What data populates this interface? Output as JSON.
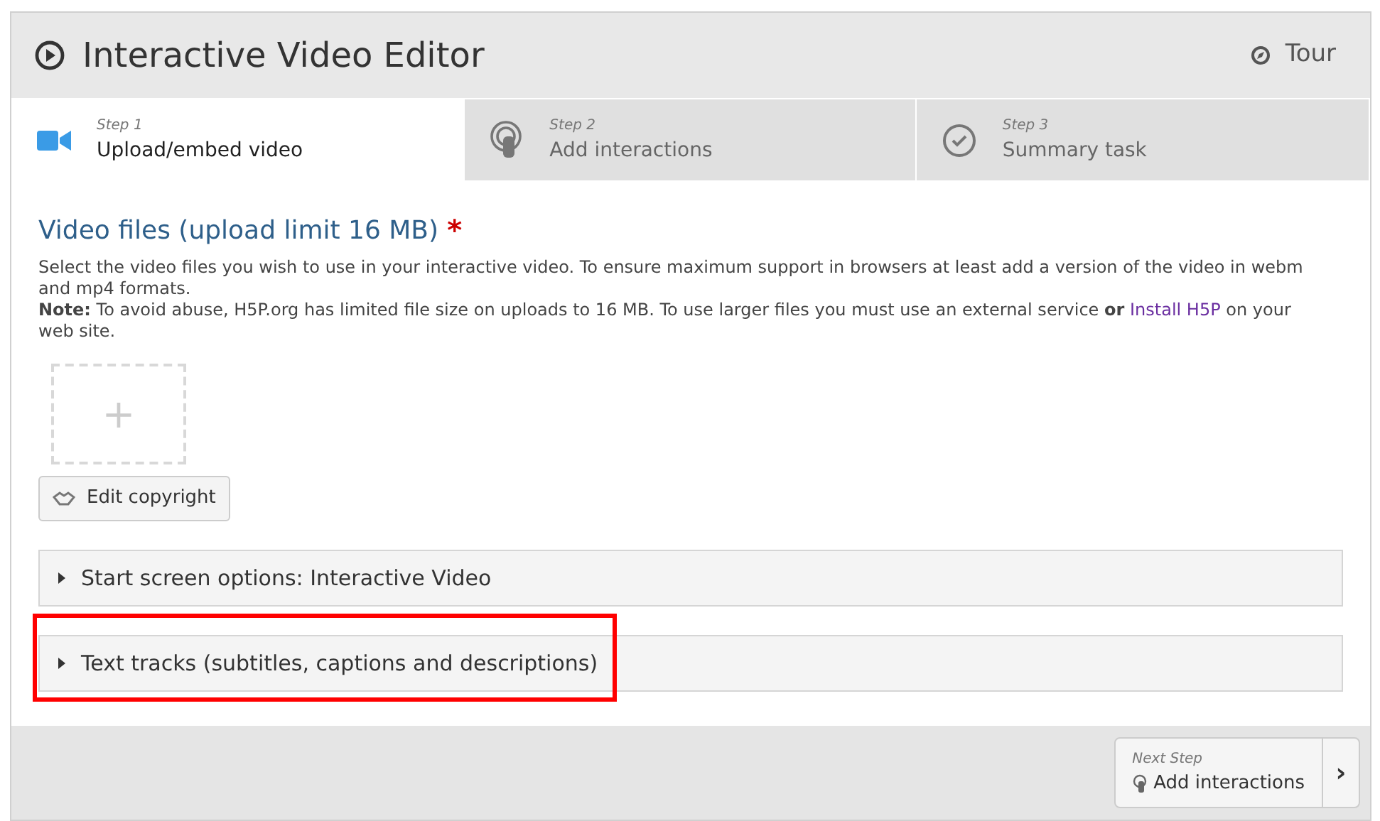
{
  "header": {
    "title": "Interactive Video Editor",
    "tour": "Tour"
  },
  "steps": [
    {
      "kind": "video",
      "step": "Step 1",
      "label": "Upload/embed video",
      "selected": true
    },
    {
      "kind": "touch",
      "step": "Step 2",
      "label": "Add interactions",
      "selected": false
    },
    {
      "kind": "check",
      "step": "Step 3",
      "label": "Summary task",
      "selected": false
    }
  ],
  "field": {
    "title": "Video files (upload limit 16 MB)",
    "required": "*",
    "description": "Select the video files you wish to use in your interactive video. To ensure maximum support in browsers at least add a version of the video in webm and mp4 formats.",
    "note": "**Note:** To avoid abuse, H5P.org has limited file size on uploads to 16 MB. To use larger files you must use an external service **or**",
    "link": "Install H5P",
    "note_end": "on your web site.",
    "add": "+",
    "copyright_button": "Edit copyright"
  },
  "sections": [
    {
      "label": "Start screen options: Interactive Video",
      "expanded": false,
      "highlighted": false
    },
    {
      "label": "Text tracks (subtitles, captions and descriptions)",
      "expanded": false,
      "highlighted": true
    }
  ],
  "footer": {
    "caption": "Next Step",
    "label": "Add interactions",
    "arrow": "›"
  }
}
